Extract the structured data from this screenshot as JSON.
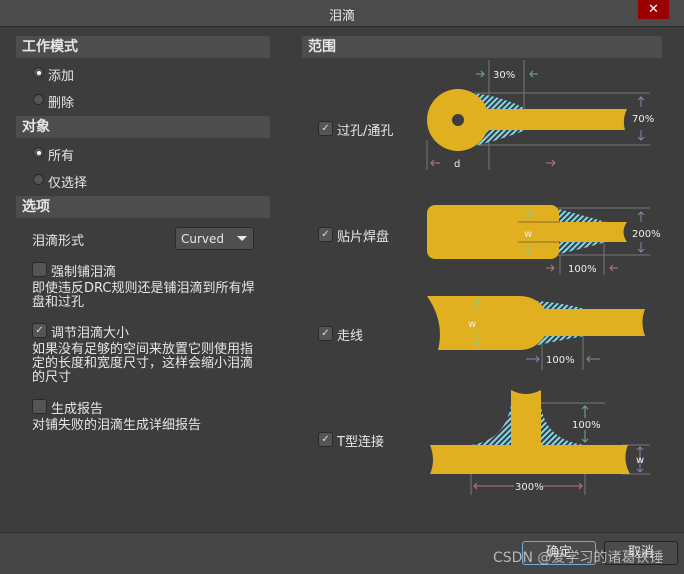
{
  "window": {
    "title": "泪滴",
    "close": "✕"
  },
  "work_mode": {
    "title": "工作模式",
    "options": [
      {
        "label": "添加",
        "selected": true
      },
      {
        "label": "删除",
        "selected": false
      }
    ]
  },
  "objects": {
    "title": "对象",
    "options": [
      {
        "label": "所有",
        "selected": true
      },
      {
        "label": "仅选择",
        "selected": false
      }
    ]
  },
  "options": {
    "title": "选项",
    "style_label": "泪滴形式",
    "style_value": "Curved",
    "force": {
      "label": "强制铺泪滴",
      "checked": false,
      "desc1": "即使违反DRC规则还是铺泪滴到所有焊",
      "desc2": "盘和过孔"
    },
    "adjust": {
      "label": "调节泪滴大小",
      "checked": true,
      "desc1": "如果没有足够的空间来放置它则使用指",
      "desc2": "定的长度和宽度尺寸，这样会缩小泪滴",
      "desc3": "的尺寸"
    },
    "report": {
      "label": "生成报告",
      "checked": false,
      "desc1": "对铺失败的泪滴生成详细报告"
    }
  },
  "scope": {
    "title": "范围",
    "items": [
      {
        "label": "过孔/通孔",
        "checked": true,
        "len": "30%",
        "width": "70%",
        "dim": "d"
      },
      {
        "label": "贴片焊盘",
        "checked": true,
        "len": "100%",
        "width": "200%",
        "dim": "w"
      },
      {
        "label": "走线",
        "checked": true,
        "len": "100%",
        "dim": "w"
      },
      {
        "label": "T型连接",
        "checked": true,
        "len": "300%",
        "width": "100%",
        "dim": "w"
      }
    ]
  },
  "colors": {
    "copper": "#e0b020",
    "hatch": "#7fd8f0",
    "bg": "#3d3d3d"
  },
  "footer": {
    "ok": "确定",
    "cancel": "取消"
  },
  "watermark": "CSDN @爱学习的诸葛铁锤"
}
